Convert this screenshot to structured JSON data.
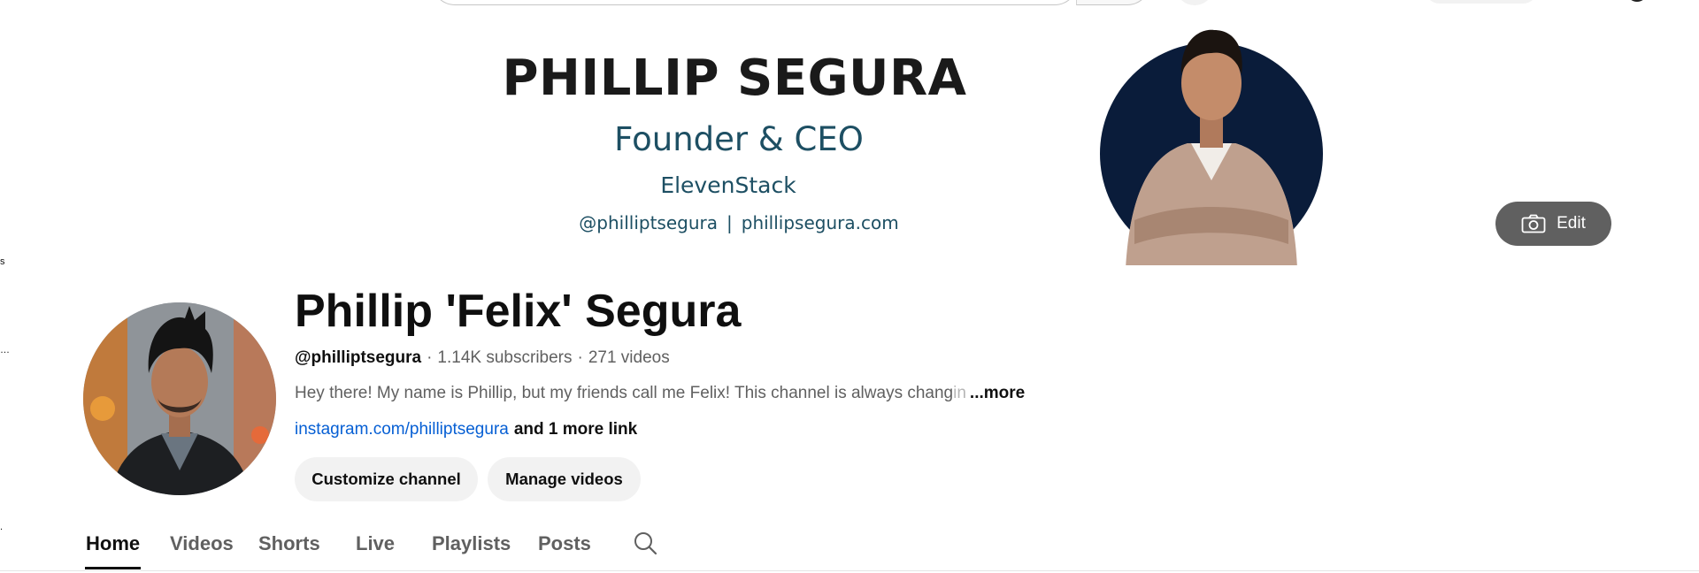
{
  "sidebar_fragments": [
    "s",
    "…",
    "."
  ],
  "banner": {
    "name": "PHILLIP SEGURA",
    "role": "Founder & CEO",
    "company": "ElevenStack",
    "handle": "@philliptsegura",
    "separator": "|",
    "website": "phillipsegura.com",
    "portrait_bg": "#0a1c3a",
    "edit_label": "Edit",
    "edit_icon": "camera-icon"
  },
  "channel": {
    "title": "Phillip 'Felix' Segura",
    "handle": "@philliptsegura",
    "dot": "·",
    "subscribers": "1.14K subscribers",
    "videos": "271 videos",
    "description": "Hey there! My name is Phillip, but my friends call me Felix! This channel is always chang",
    "description_fade": "in",
    "more_label": "...more",
    "link": "instagram.com/philliptsegura",
    "more_links": "and 1 more link",
    "customize_label": "Customize channel",
    "manage_label": "Manage videos"
  },
  "tabs": [
    {
      "label": "Home",
      "active": true
    },
    {
      "label": "Videos",
      "active": false
    },
    {
      "label": "Shorts",
      "active": false
    },
    {
      "label": "Live",
      "active": false
    },
    {
      "label": "Playlists",
      "active": false
    },
    {
      "label": "Posts",
      "active": false
    }
  ],
  "tab_search_icon": "search-icon",
  "colors": {
    "banner_text": "#1d4f63",
    "link": "#065fd4",
    "button_bg": "#f2f2f2",
    "edit_bg": "#606060"
  }
}
